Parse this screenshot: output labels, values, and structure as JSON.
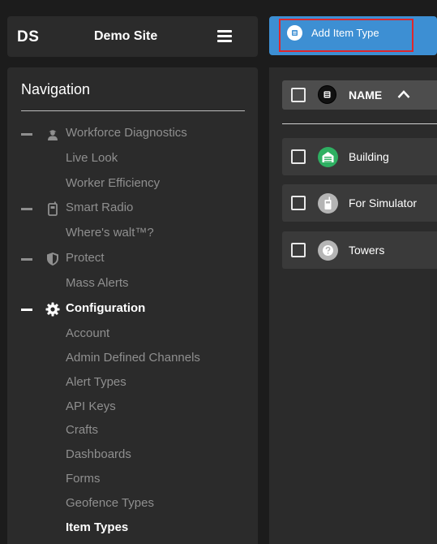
{
  "header": {
    "site_abbr": "DS",
    "site_name": "Demo Site",
    "menu_icon": "hamburger-menu-icon"
  },
  "toolbar": {
    "add_item_type_label": "Add Item Type",
    "add_icon": "list-icon",
    "accent_color": "#3d8fd3",
    "highlight_border_color": "#e0262b"
  },
  "sidebar": {
    "title": "Navigation",
    "groups": [
      {
        "label": "Workforce Diagnostics",
        "icon": "worker-icon",
        "active": false,
        "items": [
          "Live Look",
          "Worker Efficiency"
        ]
      },
      {
        "label": "Smart Radio",
        "icon": "radio-icon",
        "active": false,
        "items": [
          "Where's walt™?"
        ]
      },
      {
        "label": "Protect",
        "icon": "shield-icon",
        "active": false,
        "items": [
          "Mass Alerts"
        ]
      },
      {
        "label": "Configuration",
        "icon": "gear-icon",
        "active": true,
        "items": [
          "Account",
          "Admin Defined Channels",
          "Alert Types",
          "API Keys",
          "Crafts",
          "Dashboards",
          "Forms",
          "Geofence Types",
          "Item Types"
        ],
        "selected_item": "Item Types"
      }
    ]
  },
  "table": {
    "column_header": "NAME",
    "sort": "ascending",
    "rows": [
      {
        "label": "Building",
        "icon": "building-icon",
        "icon_color": "#2eb062"
      },
      {
        "label": "For Simulator",
        "icon": "device-icon",
        "icon_color": "#b5b5b5"
      },
      {
        "label": "Towers",
        "icon": "question-icon",
        "icon_color": "#b5b5b5"
      }
    ]
  }
}
